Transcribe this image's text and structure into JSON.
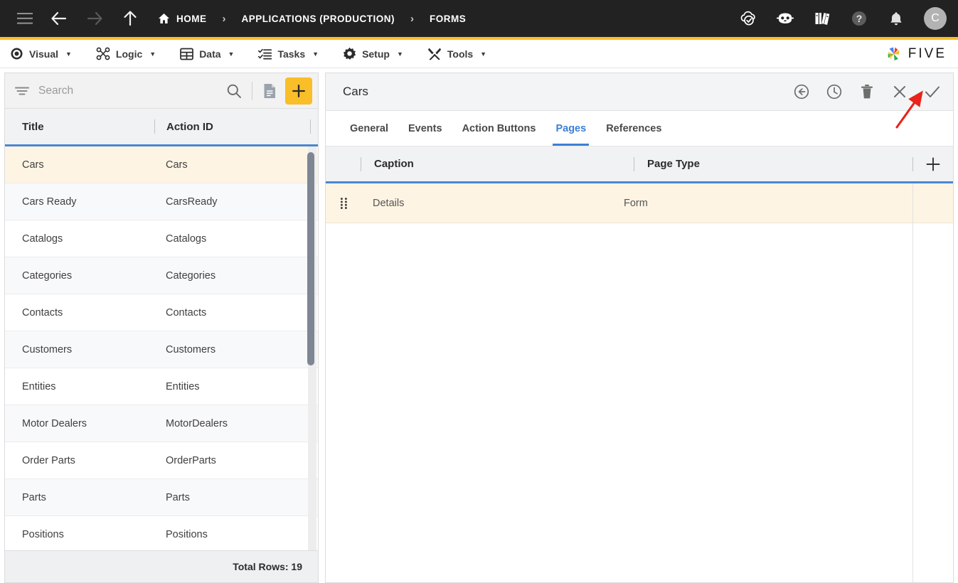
{
  "topbar": {
    "icons": {
      "menu": "hamburger-icon",
      "back": "back-arrow-icon",
      "forward": "forward-arrow-icon",
      "up": "up-arrow-icon",
      "home": "home-icon",
      "cloud": "cloud-check-icon",
      "robot": "robot-icon",
      "books": "books-icon",
      "help": "help-circle-icon",
      "bell": "bell-icon"
    },
    "breadcrumbs": [
      {
        "label": "HOME"
      },
      {
        "label": "APPLICATIONS (PRODUCTION)"
      },
      {
        "label": "FORMS"
      }
    ],
    "separator": "›",
    "avatar_initial": "C",
    "accent_color": "#F9BE28"
  },
  "menubar": {
    "items": [
      {
        "label": "Visual",
        "icon": "eye-icon"
      },
      {
        "label": "Logic",
        "icon": "node-graph-icon"
      },
      {
        "label": "Data",
        "icon": "table-grid-icon"
      },
      {
        "label": "Tasks",
        "icon": "checklist-icon"
      },
      {
        "label": "Setup",
        "icon": "gear-icon"
      },
      {
        "label": "Tools",
        "icon": "tools-icon"
      }
    ],
    "caret": "▼",
    "brand": "FIVE"
  },
  "sidebar": {
    "search": {
      "placeholder": "Search",
      "value": ""
    },
    "filter_icon": "filter-icon",
    "search_icon": "search-icon",
    "report_icon": "document-icon",
    "add_label": "+",
    "columns": [
      "Title",
      "Action ID"
    ],
    "rows": [
      {
        "title": "Cars",
        "action_id": "Cars",
        "selected": true
      },
      {
        "title": "Cars Ready",
        "action_id": "CarsReady",
        "selected": false
      },
      {
        "title": "Catalogs",
        "action_id": "Catalogs",
        "selected": false
      },
      {
        "title": "Categories",
        "action_id": "Categories",
        "selected": false
      },
      {
        "title": "Contacts",
        "action_id": "Contacts",
        "selected": false
      },
      {
        "title": "Customers",
        "action_id": "Customers",
        "selected": false
      },
      {
        "title": "Entities",
        "action_id": "Entities",
        "selected": false
      },
      {
        "title": "Motor Dealers",
        "action_id": "MotorDealers",
        "selected": false
      },
      {
        "title": "Order Parts",
        "action_id": "OrderParts",
        "selected": false
      },
      {
        "title": "Parts",
        "action_id": "Parts",
        "selected": false
      },
      {
        "title": "Positions",
        "action_id": "Positions",
        "selected": false
      }
    ],
    "footer": "Total Rows: 19"
  },
  "detail": {
    "title": "Cars",
    "actions": [
      {
        "name": "revert-icon",
        "label": "Revert"
      },
      {
        "name": "history-icon",
        "label": "History"
      },
      {
        "name": "delete-icon",
        "label": "Delete"
      },
      {
        "name": "cancel-icon",
        "label": "Cancel"
      },
      {
        "name": "save-icon",
        "label": "Save"
      }
    ],
    "tabs": [
      {
        "label": "General",
        "active": false
      },
      {
        "label": "Events",
        "active": false
      },
      {
        "label": "Action Buttons",
        "active": false
      },
      {
        "label": "Pages",
        "active": true
      },
      {
        "label": "References",
        "active": false
      }
    ],
    "pages_grid": {
      "columns": [
        "Caption",
        "Page Type"
      ],
      "add_label": "+",
      "rows": [
        {
          "caption": "Details",
          "page_type": "Form",
          "selected": true
        }
      ]
    }
  },
  "annotation": {
    "arrow_color": "#E8241C",
    "points_to": "save-icon"
  }
}
